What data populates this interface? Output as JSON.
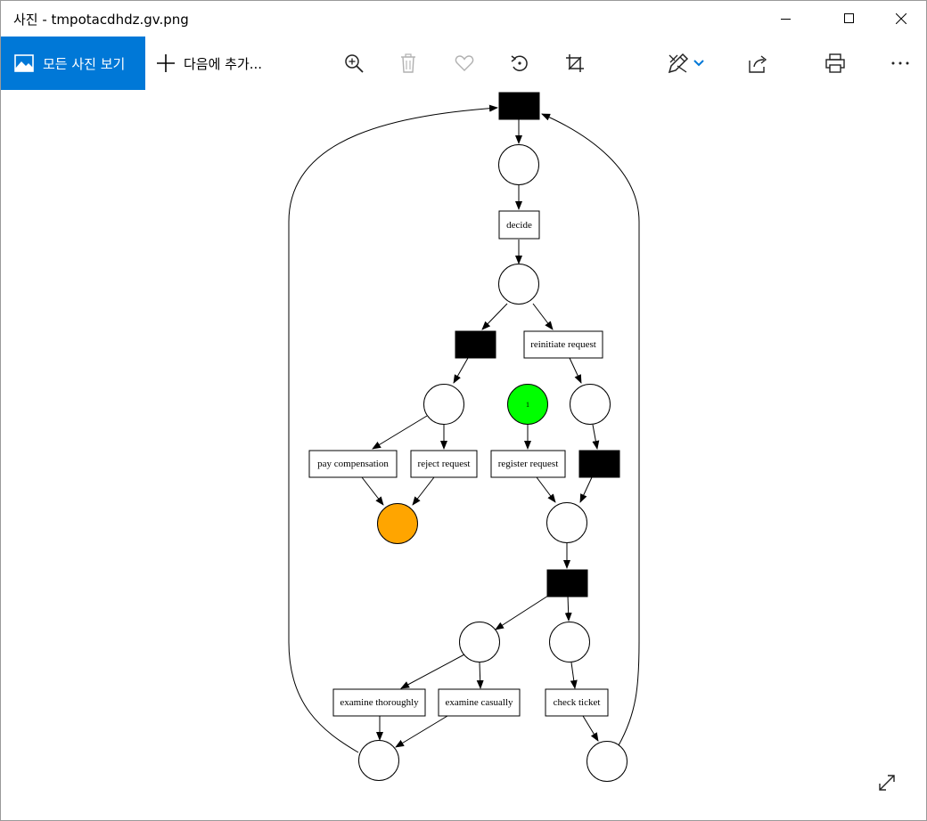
{
  "window": {
    "title": "사진 - tmpotacdhdz.gv.png",
    "minimize_icon": "minimize-icon",
    "maximize_icon": "maximize-icon",
    "close_icon": "close-icon"
  },
  "toolbar": {
    "all_photos_label": "모든 사진 보기",
    "add_to_label": "다음에 추가...",
    "icons": [
      "zoom-in-icon",
      "delete-icon",
      "favorite-icon",
      "rotate-icon",
      "crop-icon",
      "edit-create-icon",
      "share-icon",
      "print-icon",
      "more-icon"
    ],
    "accent_color": "#0078d7"
  },
  "petri_net": {
    "transitions": {
      "decide": "decide",
      "reinitiate_request": "reinitiate request",
      "pay_compensation": "pay compensation",
      "reject_request": "reject request",
      "register_request": "register request",
      "examine_thoroughly": "examine thoroughly",
      "examine_casually": "examine casually",
      "check_ticket": "check ticket"
    },
    "initial_place_tokens": "1",
    "initial_place_color": "#00ff00",
    "final_place_color": "#ffa500"
  }
}
